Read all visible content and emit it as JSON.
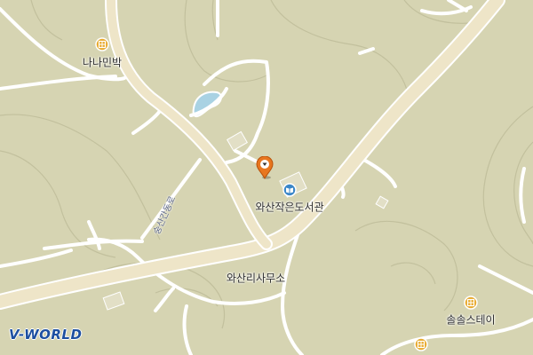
{
  "map": {
    "colors": {
      "land": "#d6d4b2",
      "major_road": "#eee5c8",
      "minor_road": "#ffffff",
      "contour": "#bdbb98",
      "water": "#a9d2e3",
      "marker": "#e8761f",
      "poi_lodging": "#e8a92c",
      "poi_library": "#3a86c8"
    },
    "labels": {
      "nanaminbak": "나나민박",
      "library": "와산작은도서관",
      "office": "와산리사무소",
      "stay": "솔솔스테이",
      "road": "숭산간동로"
    },
    "icons": {
      "lodging": "lodging-icon",
      "library": "library-icon",
      "marker": "location-pin-icon"
    },
    "logo": "V-WORLD"
  }
}
